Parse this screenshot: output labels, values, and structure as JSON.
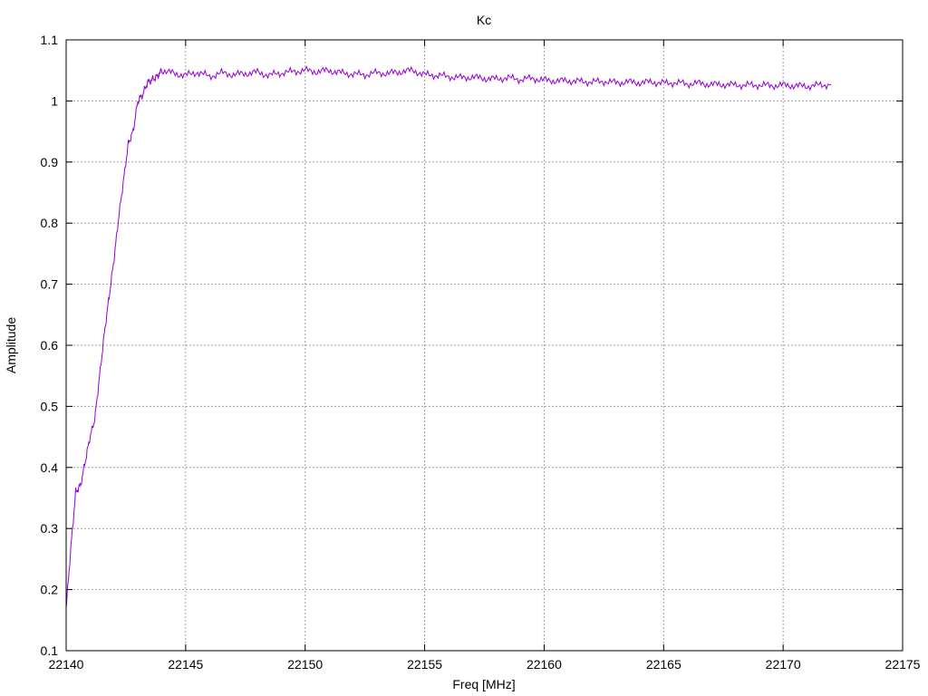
{
  "chart_data": {
    "type": "line",
    "title": "Kc",
    "xlabel": "Freq [MHz]",
    "ylabel": "Amplitude",
    "xlim": [
      22140,
      22175
    ],
    "ylim": [
      0.1,
      1.1
    ],
    "xticks": [
      "22140",
      "22145",
      "22150",
      "22155",
      "22160",
      "22165",
      "22170",
      "22175"
    ],
    "yticks": [
      "0.1",
      "0.2",
      "0.3",
      "0.4",
      "0.5",
      "0.6",
      "0.7",
      "0.8",
      "0.9",
      "1",
      "1.1"
    ],
    "grid": true,
    "legend": "none",
    "series": [
      {
        "color": "#9400d3",
        "x": [
          22140.0,
          22140.2,
          22140.4,
          22140.6,
          22140.8,
          22141.0,
          22141.2,
          22141.4,
          22141.6,
          22141.8,
          22142.0,
          22142.2,
          22142.4,
          22142.6,
          22142.8,
          22143.0,
          22143.2,
          22143.4,
          22143.6,
          22143.8,
          22144.0,
          22144.5,
          22145.0,
          22145.5,
          22146.0,
          22146.5,
          22147.0,
          22147.5,
          22148.0,
          22148.5,
          22149.0,
          22149.5,
          22150.0,
          22150.5,
          22151.0,
          22151.5,
          22152.0,
          22152.5,
          22153.0,
          22153.5,
          22154.0,
          22154.5,
          22155.0,
          22155.5,
          22156.0,
          22156.5,
          22157.0,
          22157.5,
          22158.0,
          22158.5,
          22159.0,
          22159.5,
          22160.0,
          22160.5,
          22161.0,
          22161.5,
          22162.0,
          22162.5,
          22163.0,
          22163.5,
          22164.0,
          22164.5,
          22165.0,
          22165.5,
          22166.0,
          22166.5,
          22167.0,
          22167.5,
          22168.0,
          22168.5,
          22169.0,
          22169.5,
          22170.0,
          22170.5,
          22171.0,
          22171.5,
          22172.0
        ],
        "y": [
          0.17,
          0.27,
          0.36,
          0.37,
          0.41,
          0.45,
          0.48,
          0.55,
          0.62,
          0.68,
          0.74,
          0.81,
          0.87,
          0.93,
          0.95,
          1.0,
          1.01,
          1.03,
          1.035,
          1.04,
          1.05,
          1.045,
          1.042,
          1.047,
          1.04,
          1.046,
          1.043,
          1.045,
          1.047,
          1.042,
          1.046,
          1.048,
          1.05,
          1.048,
          1.05,
          1.046,
          1.044,
          1.043,
          1.046,
          1.045,
          1.048,
          1.05,
          1.043,
          1.042,
          1.04,
          1.038,
          1.039,
          1.037,
          1.036,
          1.038,
          1.035,
          1.037,
          1.034,
          1.033,
          1.033,
          1.032,
          1.031,
          1.032,
          1.03,
          1.031,
          1.03,
          1.031,
          1.029,
          1.03,
          1.028,
          1.029,
          1.027,
          1.027,
          1.026,
          1.026,
          1.026,
          1.025,
          1.026,
          1.025,
          1.024,
          1.026,
          1.027
        ]
      }
    ]
  }
}
